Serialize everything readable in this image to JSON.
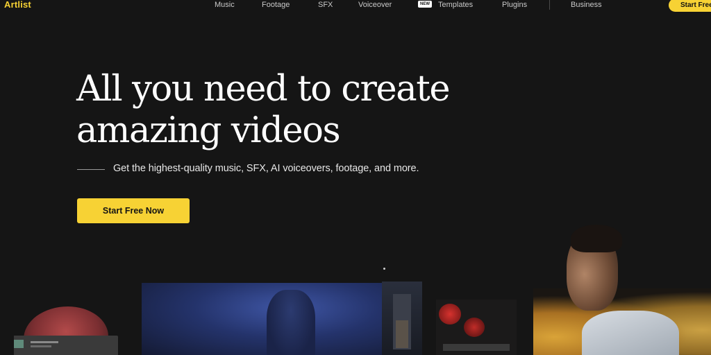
{
  "brand": {
    "logo": "Artlist",
    "accent_color": "#f7d234"
  },
  "nav": {
    "items": [
      {
        "label": "Music"
      },
      {
        "label": "Footage"
      },
      {
        "label": "SFX"
      },
      {
        "label": "Voiceover",
        "badge": "NEW"
      },
      {
        "label": "Templates"
      },
      {
        "label": "Plugins"
      },
      {
        "label": "Business"
      }
    ],
    "cta": "Start Free"
  },
  "hero": {
    "headline_line1": "All you need to create",
    "headline_line2": "amazing videos",
    "subtitle": "Get the highest-quality music, SFX, AI voiceovers, footage, and more.",
    "cta": "Start Free Now"
  }
}
